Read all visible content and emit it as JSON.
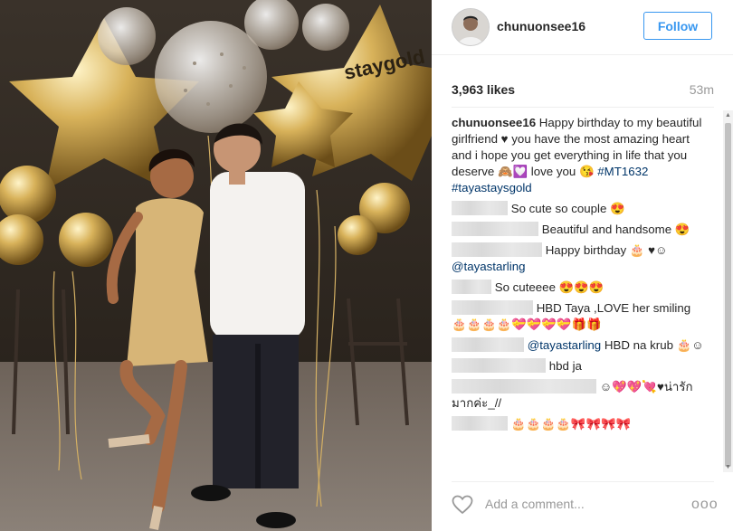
{
  "photo": {
    "balloon_text": "staygold",
    "alt": "Couple posing with gold balloons"
  },
  "header": {
    "username": "chunuonsee16",
    "follow_label": "Follow"
  },
  "stats": {
    "likes": "3,963 likes",
    "time_ago": "53m"
  },
  "caption": {
    "username": "chunuonsee16",
    "text": " Happy birthday to my beautiful girlfriend ♥ you have the most amazing heart and i hope you get everything in life that you deserve 🙈💟 love you 😘 ",
    "tag1": "#MT1632",
    "tag2": "#tayastaysgold"
  },
  "comments": [
    {
      "text": " So cute so couple 😍"
    },
    {
      "text": " Beautiful and handsome 😍"
    },
    {
      "text": " Happy birthday 🎂 ♥☺",
      "mention": "@tayastarling"
    },
    {
      "text": " So cuteeee 😍😍😍"
    },
    {
      "text": " HBD Taya ,LOVE her smiling 🎂🎂🎂🎂💝💝💝💝🎁🎁"
    },
    {
      "mention": "@tayastarling",
      "text": " HBD na krub 🎂☺"
    },
    {
      "text": " hbd ja"
    },
    {
      "text": " ☺💖💖💘♥น่ารักมากค่ะ_//"
    },
    {
      "text": " 🎂🎂🎂🎂🎀🎀🎀🎀"
    }
  ],
  "footer": {
    "add_comment_placeholder": "Add a comment...",
    "more_label": "ooo"
  },
  "colors": {
    "accent": "#3897f0",
    "hashtag": "#003569",
    "gold": "#c9a24a"
  },
  "icons": [
    "heart-icon",
    "more-options-icon",
    "scroll-up-icon",
    "scroll-down-icon"
  ]
}
